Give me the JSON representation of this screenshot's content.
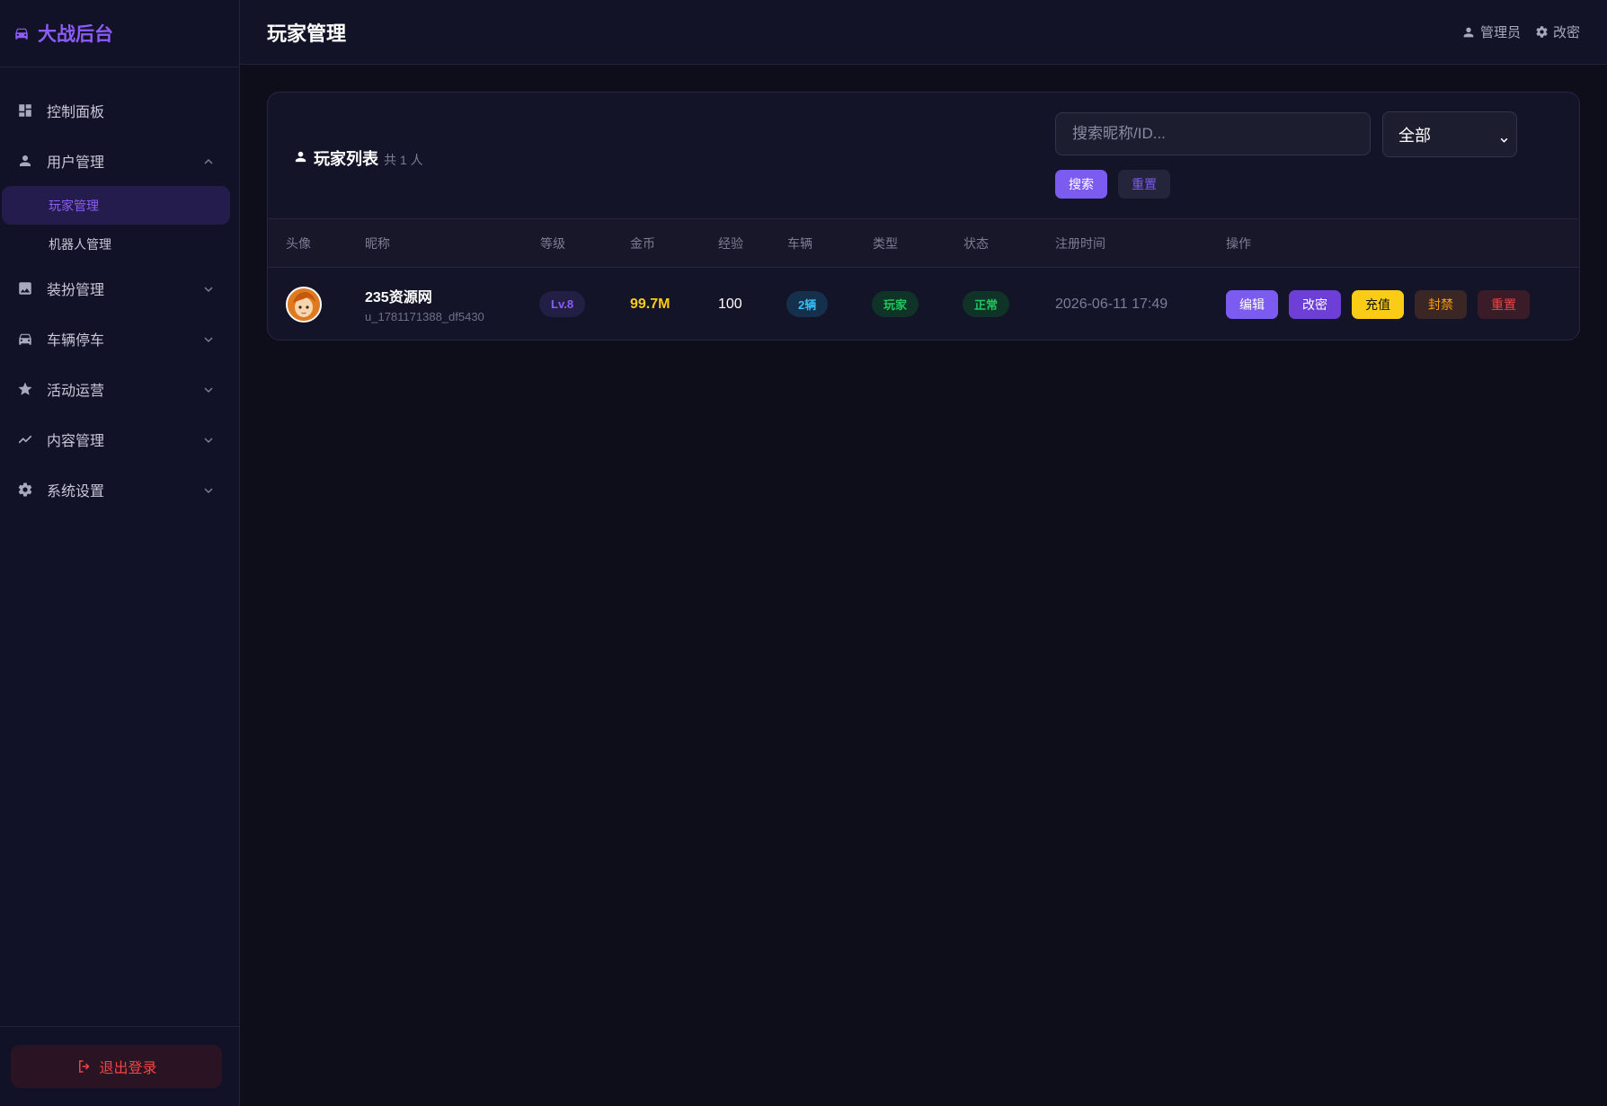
{
  "brand": {
    "title": "大战后台",
    "icon": "car-icon",
    "color": "#8b5cf6"
  },
  "sidebar": {
    "items": [
      {
        "label": "控制面板",
        "icon": "dashboard-icon"
      },
      {
        "label": "用户管理",
        "icon": "user-icon",
        "expanded": true,
        "children": [
          {
            "label": "玩家管理",
            "active": true
          },
          {
            "label": "机器人管理",
            "active": false
          }
        ]
      },
      {
        "label": "装扮管理",
        "icon": "image-icon",
        "expanded": false
      },
      {
        "label": "车辆停车",
        "icon": "car-icon",
        "expanded": false
      },
      {
        "label": "活动运营",
        "icon": "star-icon",
        "expanded": false
      },
      {
        "label": "内容管理",
        "icon": "trend-icon",
        "expanded": false
      },
      {
        "label": "系统设置",
        "icon": "gear-icon",
        "expanded": false
      }
    ],
    "logout_label": "退出登录"
  },
  "header": {
    "title": "玩家管理",
    "admin_label": "管理员",
    "change_pwd_label": "改密"
  },
  "card": {
    "title": "玩家列表",
    "count_text": "共 1 人",
    "search": {
      "placeholder": "搜索昵称/ID...",
      "value": ""
    },
    "filter": {
      "selected": "全部"
    },
    "search_button": "搜索",
    "reset_button": "重置"
  },
  "table": {
    "columns": [
      "头像",
      "昵称",
      "等级",
      "金币",
      "经验",
      "车辆",
      "类型",
      "状态",
      "注册时间",
      "操作"
    ],
    "rows": [
      {
        "nickname": "235资源网",
        "user_id": "u_1781171388_df5430",
        "level": "Lv.8",
        "coins": "99.7M",
        "exp": "100",
        "vehicles": "2辆",
        "type": "玩家",
        "status": "正常",
        "registered": "2026-06-11 17:49",
        "actions": [
          "编辑",
          "改密",
          "充值",
          "封禁",
          "重置"
        ]
      }
    ]
  },
  "colors": {
    "accent": "#7c5cf0",
    "coins": "#facc15",
    "status_ok": "#22c55e",
    "danger": "#ef4444"
  }
}
